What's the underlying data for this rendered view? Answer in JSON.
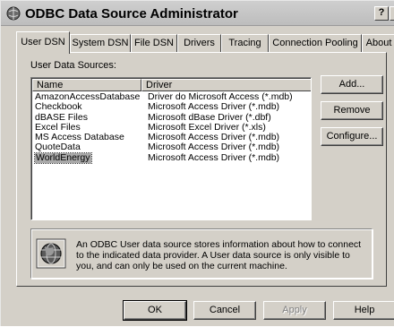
{
  "window": {
    "title": "ODBC Data Source Administrator",
    "help_btn": "?",
    "close_btn": "×"
  },
  "tabs": [
    {
      "label": "User DSN",
      "active": true
    },
    {
      "label": "System DSN"
    },
    {
      "label": "File DSN"
    },
    {
      "label": "Drivers"
    },
    {
      "label": "Tracing"
    },
    {
      "label": "Connection Pooling"
    },
    {
      "label": "About"
    }
  ],
  "user_dsn": {
    "section_label": "User Data Sources:",
    "columns": [
      "Name",
      "Driver"
    ],
    "rows": [
      {
        "name": "AmazonAccessDatabase",
        "driver": "Driver do Microsoft Access (*.mdb)"
      },
      {
        "name": "Checkbook",
        "driver": "Microsoft Access Driver (*.mdb)"
      },
      {
        "name": "dBASE Files",
        "driver": "Microsoft dBase Driver (*.dbf)"
      },
      {
        "name": "Excel Files",
        "driver": "Microsoft Excel Driver (*.xls)"
      },
      {
        "name": "MS Access Database",
        "driver": "Microsoft Access Driver (*.mdb)"
      },
      {
        "name": "QuoteData",
        "driver": "Microsoft Access Driver (*.mdb)"
      },
      {
        "name": "WorldEnergy",
        "driver": "Microsoft Access Driver (*.mdb)",
        "selected": true
      }
    ],
    "buttons": {
      "add": "Add...",
      "remove": "Remove",
      "configure": "Configure..."
    },
    "info_text": "An ODBC User data source stores information about how to connect to the indicated data provider.  A User data source is only visible to you, and can only be used on the current machine.",
    "info_icon": "odbc-globe-icon"
  },
  "footer": {
    "ok": "OK",
    "cancel": "Cancel",
    "apply": "Apply",
    "help": "Help"
  }
}
